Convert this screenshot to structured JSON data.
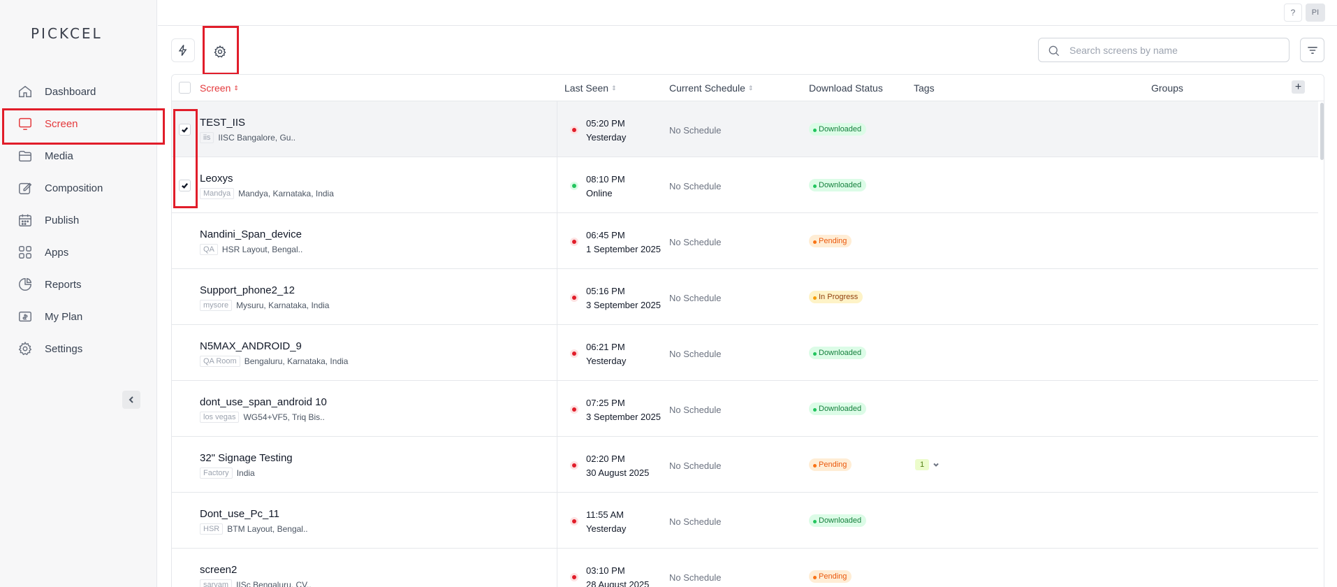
{
  "app": {
    "logo": "PICKCEL"
  },
  "sidebar": {
    "items": [
      {
        "label": "Dashboard",
        "icon": "home-icon",
        "active": false
      },
      {
        "label": "Screen",
        "icon": "monitor-icon",
        "active": true
      },
      {
        "label": "Media",
        "icon": "folder-icon",
        "active": false
      },
      {
        "label": "Composition",
        "icon": "edit-icon",
        "active": false
      },
      {
        "label": "Publish",
        "icon": "calendar-icon",
        "active": false
      },
      {
        "label": "Apps",
        "icon": "grid-icon",
        "active": false
      },
      {
        "label": "Reports",
        "icon": "pie-chart-icon",
        "active": false
      },
      {
        "label": "My Plan",
        "icon": "plan-icon",
        "active": false
      },
      {
        "label": "Settings",
        "icon": "gear-icon",
        "active": false
      }
    ]
  },
  "topbar": {
    "help": "?",
    "avatar": "PI"
  },
  "search": {
    "placeholder": "Search screens by name"
  },
  "table": {
    "headers": {
      "screen": "Screen",
      "last_seen": "Last Seen",
      "schedule": "Current Schedule",
      "download": "Download Status",
      "tags": "Tags",
      "groups": "Groups"
    },
    "rows": [
      {
        "name": "TEST_IIS",
        "tag": "iis",
        "location": "IISC Bangalore, Gu..",
        "time": "05:20 PM",
        "date": "Yesterday",
        "online": false,
        "schedule": "No Schedule",
        "status": "Downloaded",
        "status_type": "downloaded",
        "checked": true,
        "tag_count": ""
      },
      {
        "name": "Leoxys",
        "tag": "Mandya",
        "location": "Mandya, Karnataka, India",
        "time": "08:10 PM",
        "date": "Online",
        "online": true,
        "schedule": "No Schedule",
        "status": "Downloaded",
        "status_type": "downloaded",
        "checked": true,
        "tag_count": ""
      },
      {
        "name": "Nandini_Span_device",
        "tag": "QA",
        "location": "HSR Layout, Bengal..",
        "time": "06:45 PM",
        "date": "1 September 2025",
        "online": false,
        "schedule": "No Schedule",
        "status": "Pending",
        "status_type": "pending",
        "checked": false,
        "tag_count": ""
      },
      {
        "name": "Support_phone2_12",
        "tag": "mysore",
        "location": "Mysuru, Karnataka, India",
        "time": "05:16 PM",
        "date": "3 September 2025",
        "online": false,
        "schedule": "No Schedule",
        "status": "In Progress",
        "status_type": "progress",
        "checked": false,
        "tag_count": ""
      },
      {
        "name": "N5MAX_ANDROID_9",
        "tag": "QA Room",
        "location": "Bengaluru, Karnataka, India",
        "time": "06:21 PM",
        "date": "Yesterday",
        "online": false,
        "schedule": "No Schedule",
        "status": "Downloaded",
        "status_type": "downloaded",
        "checked": false,
        "tag_count": ""
      },
      {
        "name": "dont_use_span_android 10",
        "tag": "los vegas",
        "location": "WG54+VF5, Triq Bis..",
        "time": "07:25 PM",
        "date": "3 September 2025",
        "online": false,
        "schedule": "No Schedule",
        "status": "Downloaded",
        "status_type": "downloaded",
        "checked": false,
        "tag_count": ""
      },
      {
        "name": "32\" Signage Testing",
        "tag": "Factory",
        "location": "India",
        "time": "02:20 PM",
        "date": "30 August 2025",
        "online": false,
        "schedule": "No Schedule",
        "status": "Pending",
        "status_type": "pending",
        "checked": false,
        "tag_count": "1"
      },
      {
        "name": "Dont_use_Pc_11",
        "tag": "HSR",
        "location": "BTM Layout, Bengal..",
        "time": "11:55 AM",
        "date": "Yesterday",
        "online": false,
        "schedule": "No Schedule",
        "status": "Downloaded",
        "status_type": "downloaded",
        "checked": false,
        "tag_count": ""
      },
      {
        "name": "screen2",
        "tag": "sarvam",
        "location": "IISc Bengaluru, CV..",
        "time": "03:10 PM",
        "date": "28 August 2025",
        "online": false,
        "schedule": "No Schedule",
        "status": "Pending",
        "status_type": "pending",
        "checked": false,
        "tag_count": ""
      }
    ]
  },
  "colors": {
    "accent": "#e4393c",
    "highlight": "#e11d2a"
  }
}
